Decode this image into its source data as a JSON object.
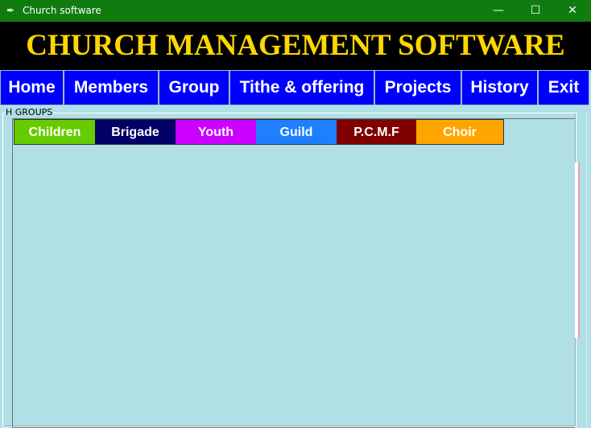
{
  "window": {
    "title": "Church software",
    "minimize": "—",
    "maximize": "☐",
    "close": "✕"
  },
  "banner": {
    "heading": "CHURCH MANAGEMENT SOFTWARE",
    "color": "#ffd700"
  },
  "nav": {
    "items": [
      {
        "label": "Home"
      },
      {
        "label": "Members"
      },
      {
        "label": "Group"
      },
      {
        "label": "Tithe & offering"
      },
      {
        "label": "Projects"
      },
      {
        "label": "History"
      },
      {
        "label": "Exit"
      }
    ],
    "color": "#0000ff"
  },
  "groups": {
    "label": "H  GROUPS",
    "tabs": [
      {
        "label": "Children",
        "color": "#66cc00"
      },
      {
        "label": "Brigade",
        "color": "#000066"
      },
      {
        "label": "Youth",
        "color": "#cc00ff"
      },
      {
        "label": "Guild",
        "color": "#1e80ff"
      },
      {
        "label": "P.C.M.F",
        "color": "#800000"
      },
      {
        "label": "Choir",
        "color": "#ffa500"
      }
    ]
  }
}
